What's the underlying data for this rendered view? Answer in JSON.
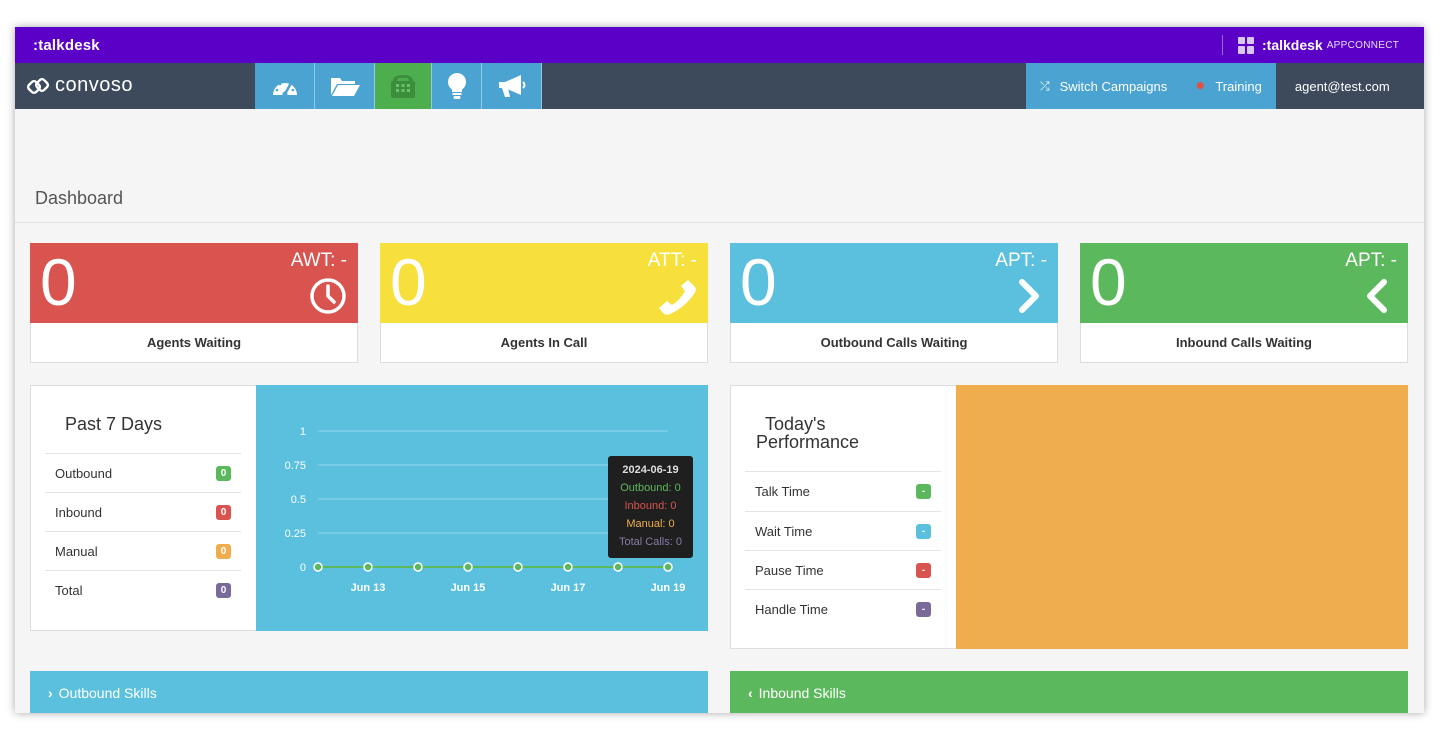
{
  "talkdesk": {
    "logo": ":talkdesk",
    "brand": ":talkdesk",
    "sub": "APPCONNECT"
  },
  "nav": {
    "brand": "convoso",
    "icons": [
      "speedometer-icon",
      "folder-open-icon",
      "phone-icon",
      "lightbulb-icon",
      "megaphone-icon"
    ],
    "switch_label": "Switch Campaigns",
    "training_label": "Training",
    "user": "agent@test.com"
  },
  "page": {
    "title": "Dashboard"
  },
  "stats": [
    {
      "value": "0",
      "metric": "AWT: -",
      "label": "Agents Waiting",
      "color": "#d9534f",
      "icon": "clock-icon"
    },
    {
      "value": "0",
      "metric": "ATT: -",
      "label": "Agents In Call",
      "color": "#f7e03c",
      "icon": "phone-icon"
    },
    {
      "value": "0",
      "metric": "APT: -",
      "label": "Outbound Calls Waiting",
      "color": "#5bc0de",
      "icon": "chevron-right-icon"
    },
    {
      "value": "0",
      "metric": "APT: -",
      "label": "Inbound Calls Waiting",
      "color": "#5cb85c",
      "icon": "chevron-left-icon"
    }
  ],
  "past7": {
    "title": "Past 7 Days",
    "rows": [
      {
        "label": "Outbound",
        "value": "0",
        "color": "#5cb85c"
      },
      {
        "label": "Inbound",
        "value": "0",
        "color": "#d9534f"
      },
      {
        "label": "Manual",
        "value": "0",
        "color": "#f0ad4e"
      },
      {
        "label": "Total",
        "value": "0",
        "color": "#7a6a9a"
      }
    ]
  },
  "chart_data": {
    "type": "line",
    "x": [
      "Jun 12",
      "Jun 13",
      "Jun 14",
      "Jun 15",
      "Jun 16",
      "Jun 17",
      "Jun 18",
      "Jun 19"
    ],
    "x_tick_labels": [
      "Jun 13",
      "Jun 15",
      "Jun 17",
      "Jun 19"
    ],
    "series": [
      {
        "name": "Outbound",
        "values": [
          0,
          0,
          0,
          0,
          0,
          0,
          0,
          0
        ],
        "color": "#5cb85c"
      }
    ],
    "y_ticks": [
      "1",
      "0.75",
      "0.5",
      "0.25",
      "0"
    ],
    "ylim": [
      0,
      1
    ],
    "grid": true,
    "tooltip": {
      "title": "2024-06-19",
      "outbound": "Outbound: 0",
      "inbound": "Inbound: 0",
      "manual": "Manual: 0",
      "total": "Total Calls: 0"
    }
  },
  "performance": {
    "title_line1": "Today's",
    "title_line2": "Performance",
    "rows": [
      {
        "label": "Talk Time",
        "value": "-",
        "color": "#5cb85c"
      },
      {
        "label": "Wait Time",
        "value": "-",
        "color": "#5bc0de"
      },
      {
        "label": "Pause Time",
        "value": "-",
        "color": "#d9534f"
      },
      {
        "label": "Handle Time",
        "value": "-",
        "color": "#7a6a9a"
      }
    ]
  },
  "skills": {
    "outbound": "Outbound Skills",
    "inbound": "Inbound Skills"
  }
}
